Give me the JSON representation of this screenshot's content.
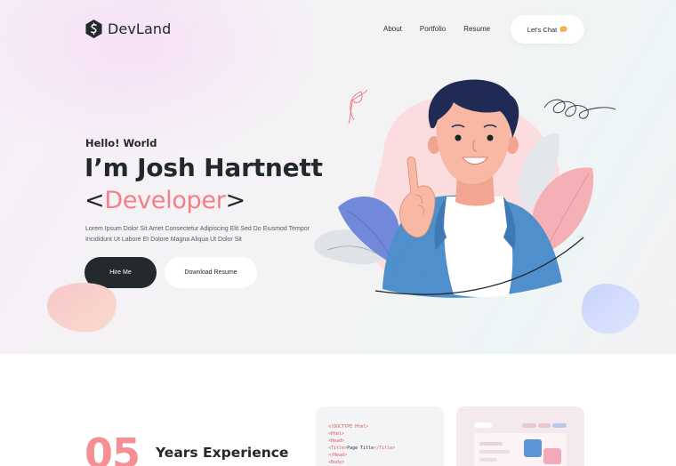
{
  "brand": {
    "name": "DevLand"
  },
  "nav": {
    "items": [
      "About",
      "Portfolio",
      "Resume"
    ]
  },
  "header": {
    "cta_label": "Let's Chat",
    "cta_icon": "chat-bubble-icon"
  },
  "hero": {
    "greeting": "Hello! World",
    "name": "I’m Josh Hartnett",
    "role_open": "<",
    "role": "Developer",
    "role_close": ">",
    "description": "Lorem Ipsum Dolor Sit Amet Consectetur Adipiscing Elit Sed Do Eiusmod Tempor Incididunt Ut Labore Et Dolore Magna Aliqua Ut Dolor Sit",
    "primary_button": "Hire Me",
    "secondary_button": "Download Resume"
  },
  "stats": {
    "number": "05",
    "label": "Years Experience"
  },
  "code_card": {
    "lines": [
      {
        "tag": "<!DOCTYPE Html>",
        "text": ""
      },
      {
        "tag": "<Html>",
        "text": ""
      },
      {
        "tag": "<Head>",
        "text": ""
      },
      {
        "tag": "<Title>",
        "text": "Page Title",
        "close": "</Title>"
      },
      {
        "tag": "</Head>",
        "text": ""
      },
      {
        "tag": "<Body>",
        "text": ""
      }
    ]
  },
  "colors": {
    "accent": "#f47f86",
    "dark": "#23292d",
    "jacket": "#4e8fcc",
    "leaf_blue": "#6f86d6",
    "leaf_pink": "#f5aab0"
  }
}
